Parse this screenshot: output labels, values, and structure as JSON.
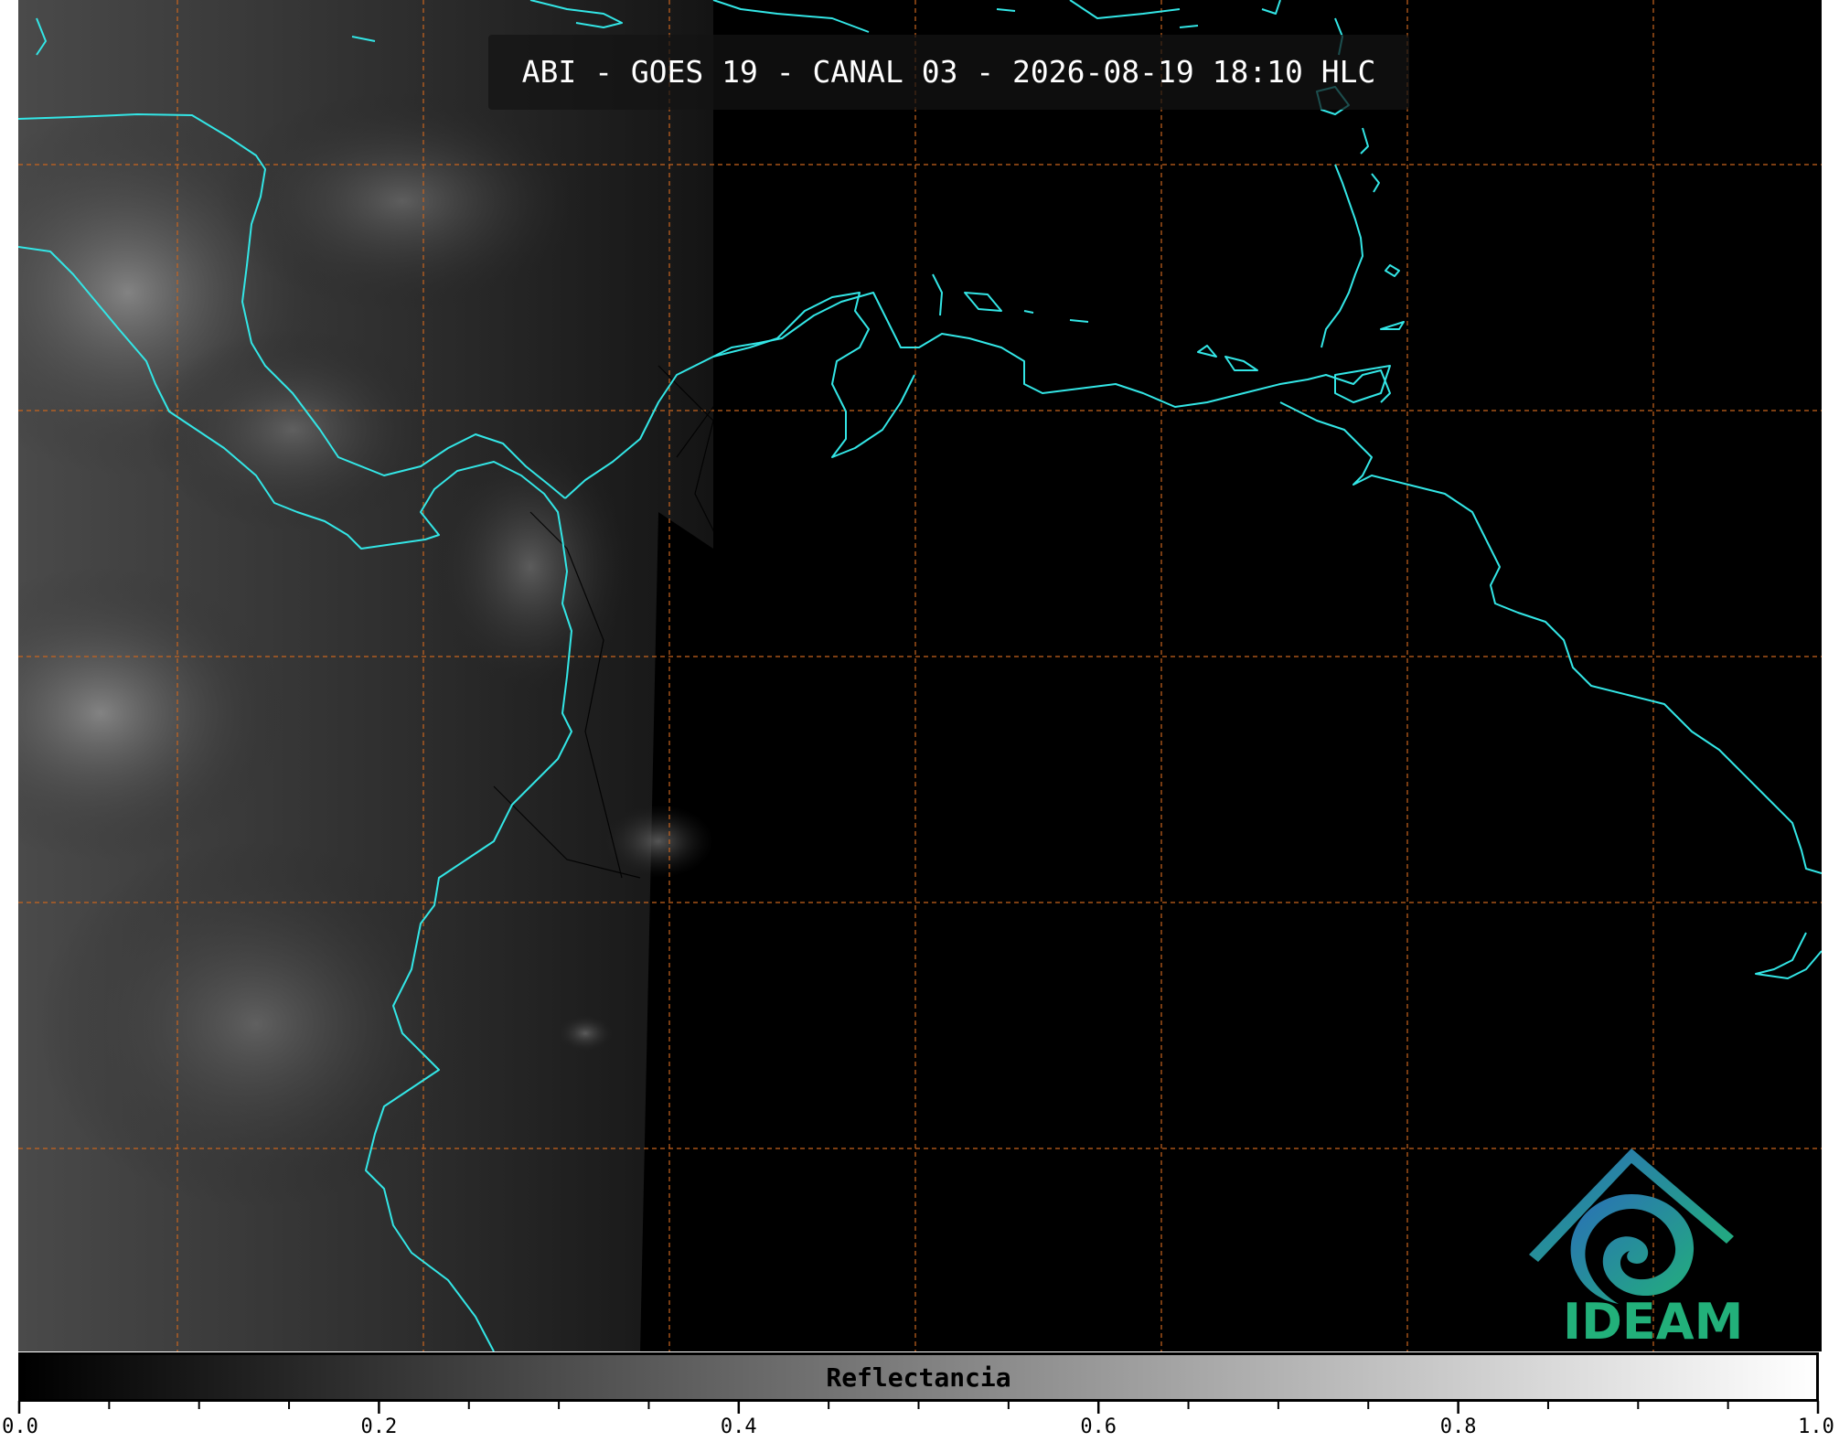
{
  "title": "ABI - GOES 19 - CANAL 03 - 2026-08-19 18:10 HLC",
  "logo": {
    "text": "IDEAM",
    "icon": "ideam-logo-icon",
    "color": "#22b07a"
  },
  "colorbar": {
    "label": "Reflectancia",
    "min": 0.0,
    "max": 1.0,
    "major_ticks": [
      "0.0",
      "0.2",
      "0.4",
      "0.6",
      "0.8",
      "1.0"
    ],
    "minor_step": 0.05,
    "colormap": "grayscale"
  },
  "colors": {
    "coastline": "#33e6e6",
    "gridline": "#c8641e",
    "background": "#000000",
    "borders": "#000000"
  }
}
